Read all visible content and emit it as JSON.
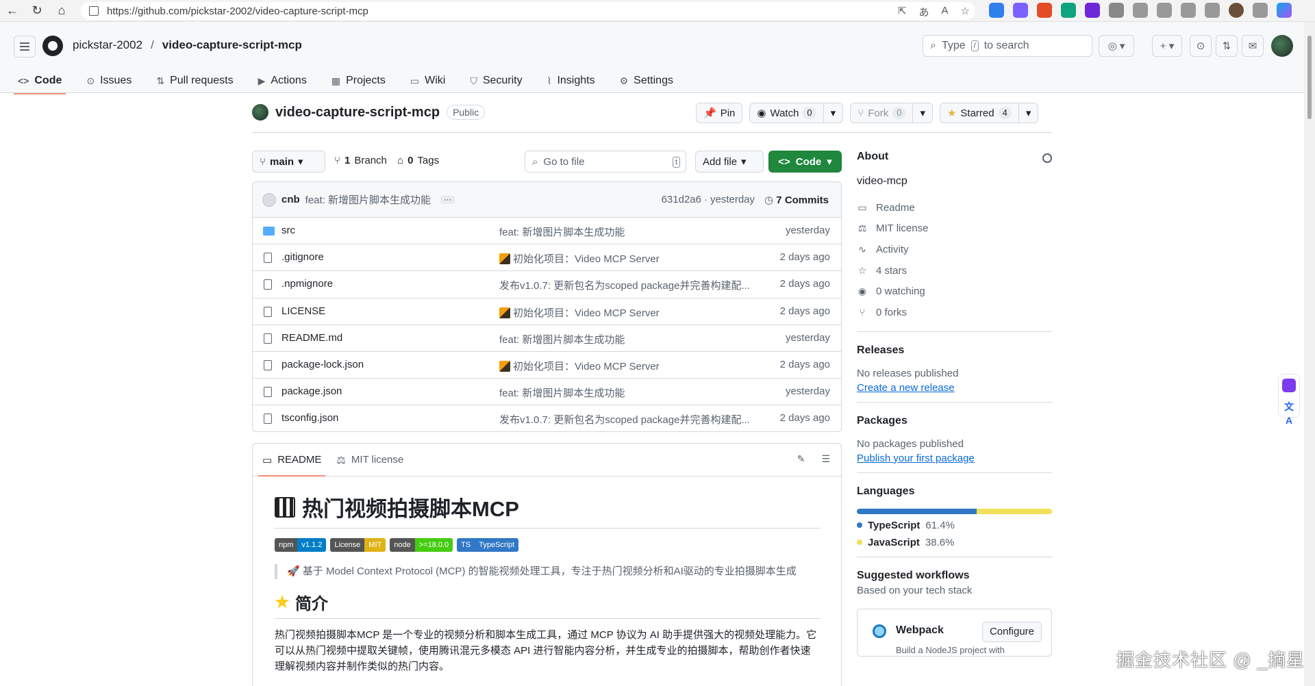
{
  "browser": {
    "url": "https://github.com/pickstar-2002/video-capture-script-mcp"
  },
  "header": {
    "owner": "pickstar-2002",
    "separator": "/",
    "repo": "video-capture-script-mcp",
    "search_prefix": "Type",
    "search_key": "/",
    "search_suffix": "to search"
  },
  "repo_nav": [
    {
      "label": "Code",
      "icon": "code-icon"
    },
    {
      "label": "Issues",
      "icon": "issues-icon"
    },
    {
      "label": "Pull requests",
      "icon": "pull-request-icon"
    },
    {
      "label": "Actions",
      "icon": "actions-icon"
    },
    {
      "label": "Projects",
      "icon": "projects-icon"
    },
    {
      "label": "Wiki",
      "icon": "book-icon"
    },
    {
      "label": "Security",
      "icon": "shield-icon"
    },
    {
      "label": "Insights",
      "icon": "graph-icon"
    },
    {
      "label": "Settings",
      "icon": "gear-icon"
    }
  ],
  "repo_title": {
    "name": "video-capture-script-mcp",
    "visibility": "Public",
    "pin": "Pin",
    "watch": "Watch",
    "watch_count": "0",
    "fork": "Fork",
    "fork_count": "0",
    "starred": "Starred",
    "star_count": "4"
  },
  "toolbar": {
    "branch": "main",
    "branch_count": "1",
    "branch_label": "Branch",
    "tag_count": "0",
    "tag_label": "Tags",
    "go_to_file": "Go to file",
    "go_to_file_key": "t",
    "add_file": "Add file",
    "code": "Code"
  },
  "commit": {
    "author": "cnb",
    "message": "feat: 新增图片脚本生成功能",
    "hash": "631d2a6",
    "dot": "·",
    "time": "yesterday",
    "count": "7",
    "count_label": "Commits"
  },
  "files": [
    {
      "name": "src",
      "type": "folder",
      "message": "feat: 新增图片脚本生成功能",
      "emoji": false,
      "time": "yesterday"
    },
    {
      "name": ".gitignore",
      "type": "file",
      "message": "初始化项目：Video MCP Server",
      "emoji": true,
      "time": "2 days ago"
    },
    {
      "name": ".npmignore",
      "type": "file",
      "message": "发布v1.0.7: 更新包名为scoped package并完善构建配...",
      "emoji": false,
      "time": "2 days ago"
    },
    {
      "name": "LICENSE",
      "type": "file",
      "message": "初始化项目：Video MCP Server",
      "emoji": true,
      "time": "2 days ago"
    },
    {
      "name": "README.md",
      "type": "file",
      "message": "feat: 新增图片脚本生成功能",
      "emoji": false,
      "time": "yesterday"
    },
    {
      "name": "package-lock.json",
      "type": "file",
      "message": "初始化项目：Video MCP Server",
      "emoji": true,
      "time": "2 days ago"
    },
    {
      "name": "package.json",
      "type": "file",
      "message": "feat: 新增图片脚本生成功能",
      "emoji": false,
      "time": "yesterday"
    },
    {
      "name": "tsconfig.json",
      "type": "file",
      "message": "发布v1.0.7: 更新包名为scoped package并完善构建配...",
      "emoji": false,
      "time": "2 days ago"
    }
  ],
  "readme": {
    "tab_readme": "README",
    "tab_license": "MIT license",
    "h1": "热门视频拍摄脚本MCP",
    "badges": [
      {
        "label": "npm",
        "value": "v1.1.2",
        "label_color": "#555555",
        "value_color": "#007ec6"
      },
      {
        "label": "License",
        "value": "MIT",
        "label_color": "#555555",
        "value_color": "#dfb317"
      },
      {
        "label": "node",
        "value": ">=18.0.0",
        "label_color": "#555555",
        "value_color": "#44cc11"
      },
      {
        "label": "TS",
        "value": "TypeScript",
        "label_color": "#3178c6",
        "value_color": "#3178c6"
      }
    ],
    "quote": "基于 Model Context Protocol (MCP) 的智能视频处理工具，专注于热门视频分析和AI驱动的专业拍摄脚本生成",
    "h2": "简介",
    "paragraph": "热门视频拍摄脚本MCP 是一个专业的视频分析和脚本生成工具，通过 MCP 协议为 AI 助手提供强大的视频处理能力。它可以从热门视频中提取关键帧，使用腾讯混元多模态 API 进行智能内容分析，并生成专业的拍摄脚本，帮助创作者快速理解视频内容并制作类似的热门内容。"
  },
  "about": {
    "title": "About",
    "description": "video-mcp",
    "items": [
      {
        "icon": "book-icon",
        "label": "Readme"
      },
      {
        "icon": "scale-icon",
        "label": "MIT license"
      },
      {
        "icon": "pulse-icon",
        "label": "Activity"
      },
      {
        "icon": "star-icon",
        "label": "4 stars"
      },
      {
        "icon": "eye-icon",
        "label": "0 watching"
      },
      {
        "icon": "fork-icon",
        "label": "0 forks"
      }
    ]
  },
  "releases": {
    "title": "Releases",
    "note": "No releases published",
    "link": "Create a new release"
  },
  "packages": {
    "title": "Packages",
    "note": "No packages published",
    "link": "Publish your first package"
  },
  "languages": {
    "title": "Languages",
    "items": [
      {
        "name": "TypeScript",
        "percent": "61.4%",
        "value": 61.4,
        "color": "#3178c6"
      },
      {
        "name": "JavaScript",
        "percent": "38.6%",
        "value": 38.6,
        "color": "#f1e05a"
      }
    ]
  },
  "workflows": {
    "title": "Suggested workflows",
    "subtitle": "Based on your tech stack",
    "card_name": "Webpack",
    "card_button": "Configure",
    "card_desc": "Build a NodeJS project with"
  },
  "watermark": "掘金技术社区 @ _摘星_"
}
